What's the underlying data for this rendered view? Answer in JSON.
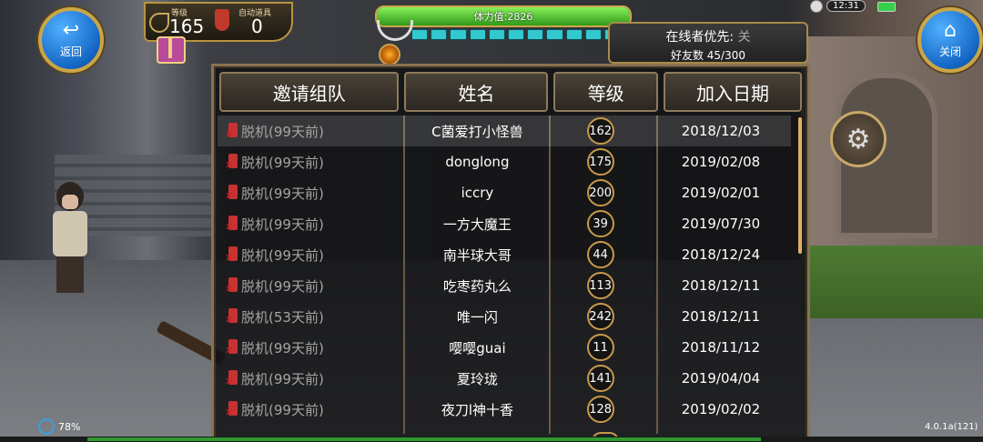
{
  "hud": {
    "back_label": "返回",
    "close_label": "关闭",
    "level_label": "等级",
    "level_value": "165",
    "auto_item_label": "自动道具",
    "auto_item_value": "0",
    "stamina_text": "体力值:2826",
    "stamina_fill": 1.0,
    "clock": "12:31",
    "battery_percent": "78%",
    "version": "4.0.1a(121)"
  },
  "online": {
    "priority_label": "在线者优先:",
    "priority_value": "关",
    "friends_count": "好友数 45/300"
  },
  "table": {
    "headers": [
      "邀请组队",
      "姓名",
      "等级",
      "加入日期"
    ],
    "rows": [
      {
        "status": "脱机(99天前)",
        "name": "C菌爱打小怪兽",
        "level": "162",
        "date": "2018/12/03"
      },
      {
        "status": "脱机(99天前)",
        "name": "donglong",
        "level": "175",
        "date": "2019/02/08"
      },
      {
        "status": "脱机(99天前)",
        "name": "iccry",
        "level": "200",
        "date": "2019/02/01"
      },
      {
        "status": "脱机(99天前)",
        "name": "一方大魔王",
        "level": "39",
        "date": "2019/07/30"
      },
      {
        "status": "脱机(99天前)",
        "name": "南半球大哥",
        "level": "44",
        "date": "2018/12/24"
      },
      {
        "status": "脱机(99天前)",
        "name": "吃枣药丸么",
        "level": "113",
        "date": "2018/12/11"
      },
      {
        "status": "脱机(53天前)",
        "name": "唯一闪",
        "level": "242",
        "date": "2018/12/11"
      },
      {
        "status": "脱机(99天前)",
        "name": "嘤嘤guai",
        "level": "11",
        "date": "2018/11/12"
      },
      {
        "status": "脱机(99天前)",
        "name": "夏玲珑",
        "level": "141",
        "date": "2019/04/04"
      },
      {
        "status": "脱机(99天前)",
        "name": "夜刀l神十香",
        "level": "128",
        "date": "2019/02/02"
      }
    ]
  }
}
